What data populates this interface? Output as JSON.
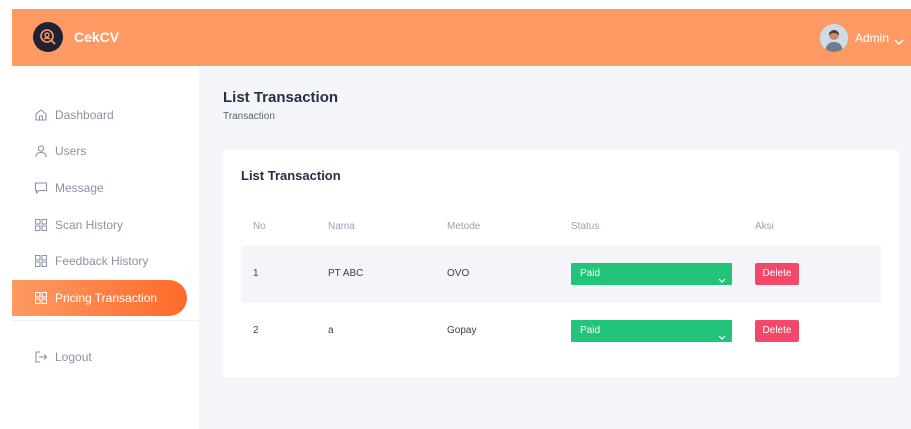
{
  "app": {
    "brand": "CekCV",
    "user": "Admin"
  },
  "sidebar": {
    "items": [
      {
        "label": "Dashboard",
        "icon": "home-icon"
      },
      {
        "label": "Users",
        "icon": "user-icon"
      },
      {
        "label": "Message",
        "icon": "message-icon"
      },
      {
        "label": "Scan History",
        "icon": "grid-icon"
      },
      {
        "label": "Feedback History",
        "icon": "grid-icon"
      },
      {
        "label": "Pricing Transaction",
        "icon": "grid-icon",
        "active": true
      }
    ],
    "logout": "Logout"
  },
  "page": {
    "title": "List Transaction",
    "breadcrumb": "Transaction"
  },
  "card": {
    "title": "List Transaction",
    "columns": [
      "No",
      "Nama",
      "Metode",
      "Status",
      "Aksi"
    ],
    "rows": [
      {
        "no": "1",
        "nama": "PT ABC",
        "metode": "OVO",
        "status": "Paid",
        "action": "Delete"
      },
      {
        "no": "2",
        "nama": "a",
        "metode": "Gopay",
        "status": "Paid",
        "action": "Delete"
      }
    ]
  },
  "colors": {
    "accent": "#fd9a63",
    "status_paid": "#22c47a",
    "delete": "#f2496b"
  }
}
